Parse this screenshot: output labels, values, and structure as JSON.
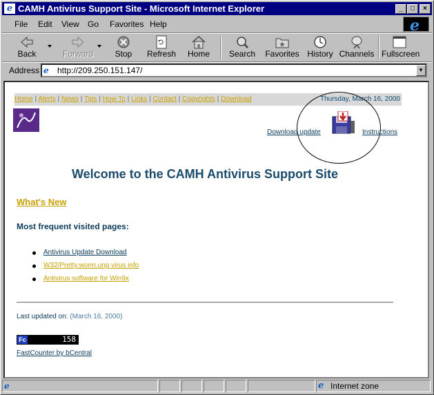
{
  "window": {
    "title": "CAMH Antivirus Support Site - Microsoft Internet Explorer",
    "min": "_",
    "max": "□",
    "close": "×"
  },
  "menu": [
    {
      "label": "File"
    },
    {
      "label": "Edit"
    },
    {
      "label": "View"
    },
    {
      "label": "Go"
    },
    {
      "label": "Favorites"
    },
    {
      "label": "Help"
    }
  ],
  "toolbar": {
    "back": "Back",
    "forward": "Forward",
    "stop": "Stop",
    "refresh": "Refresh",
    "home": "Home",
    "search": "Search",
    "favorites": "Favorites",
    "history": "History",
    "channels": "Channels",
    "fullscreen": "Fullscreen"
  },
  "address": {
    "label": "Address",
    "url": "http://209.250.151.147/"
  },
  "page": {
    "nav": [
      "Home",
      "Alerts",
      "News",
      "Tips",
      "How To",
      "Links",
      "Contact",
      "Copyrights",
      "Download"
    ],
    "date": "Thursday, March 16, 2000",
    "download_update": "Download update",
    "instructions": "Instructions",
    "welcome": "Welcome to the CAMH Antivirus Support Site",
    "whats_new": "What's New",
    "most_frequent": "Most frequent visited pages:",
    "links": [
      {
        "text": "Antivirus Update Download",
        "color": "#0a3a5a"
      },
      {
        "text": "W32/Pretty.worm.unp virus info",
        "color": "#c8a000"
      },
      {
        "text": "Antivirus software for Win9x",
        "color": "#c8a000"
      }
    ],
    "last_updated_label": "Last updated on:",
    "last_updated_date": "(March 16, 2000)",
    "counter_badge": "Fc",
    "counter_value": "158",
    "fastcounter": "FastCounter by bCentral"
  },
  "status": {
    "zone": "Internet zone"
  }
}
